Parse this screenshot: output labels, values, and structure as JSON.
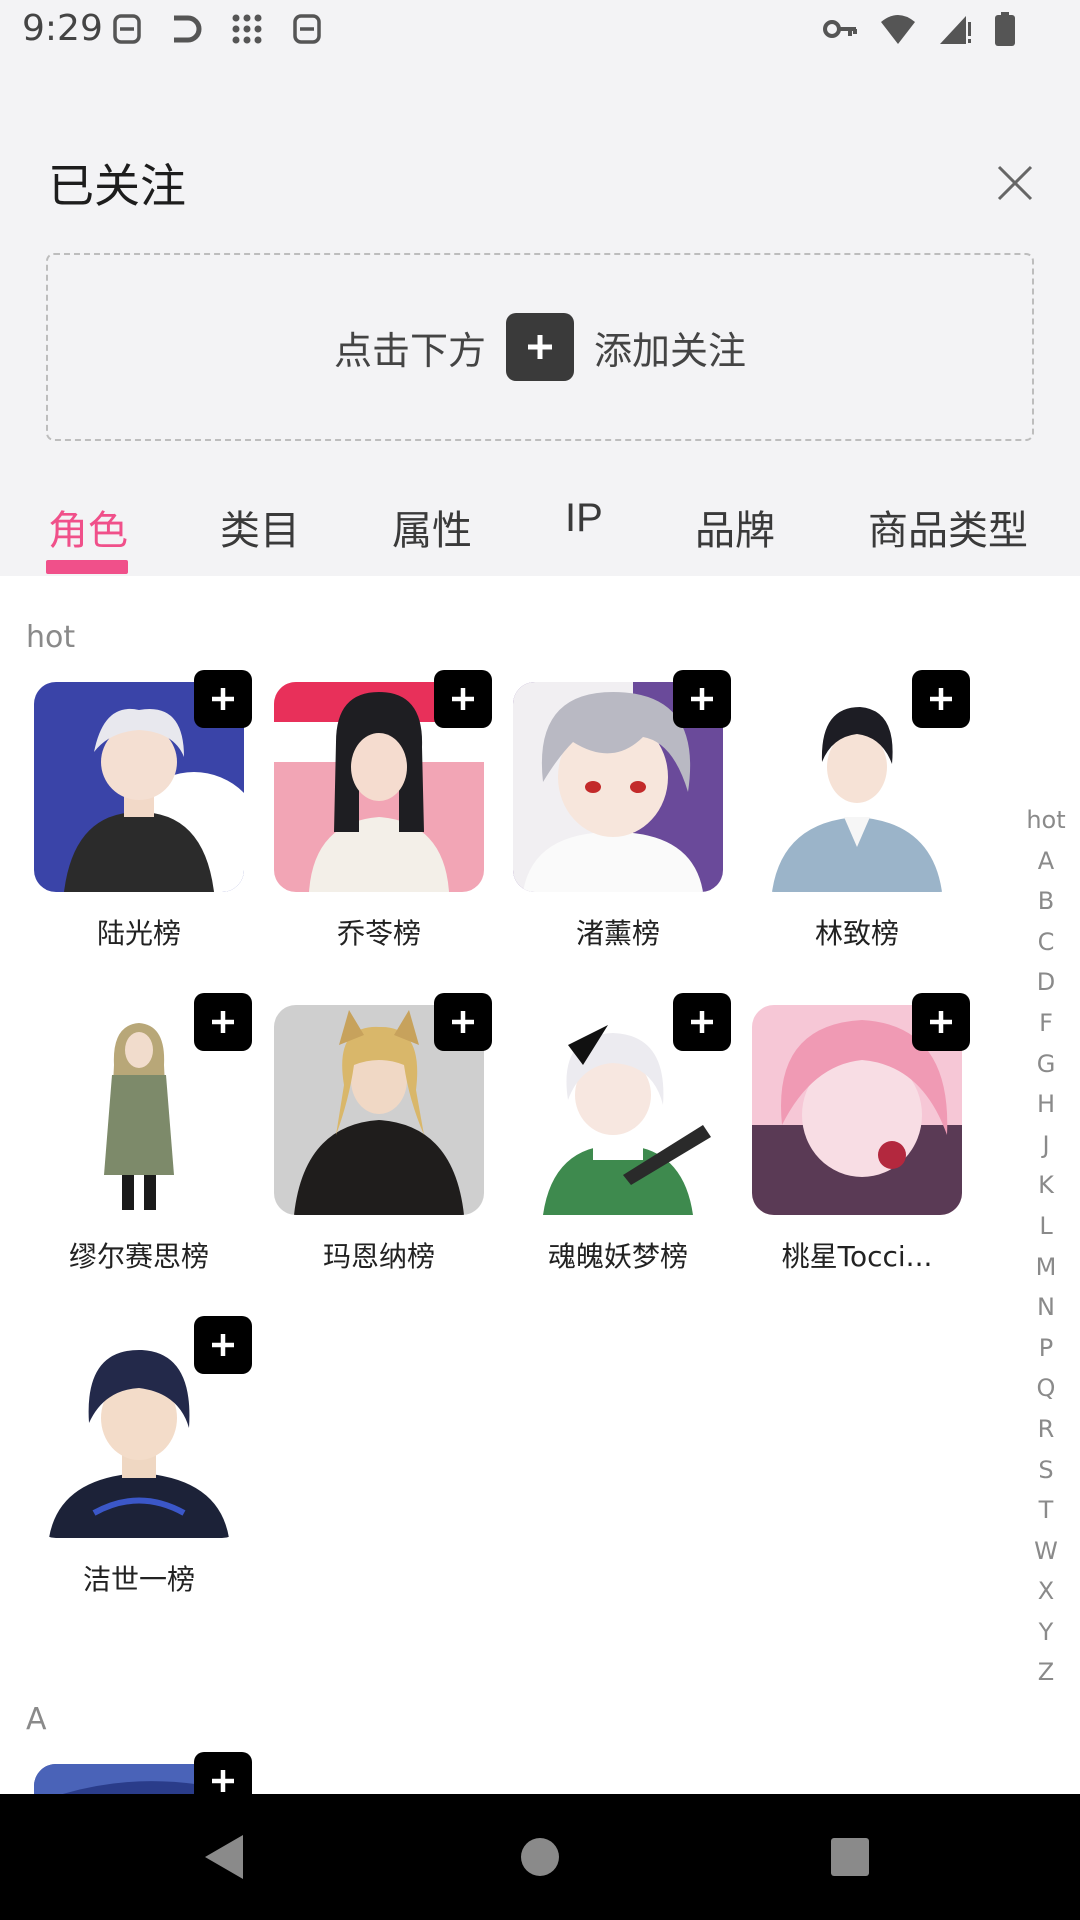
{
  "status_bar": {
    "time": "9:29"
  },
  "header": {
    "title": "已关注"
  },
  "follow_box": {
    "hint_prefix": "点击下方",
    "hint_suffix": "添加关注"
  },
  "tabs": [
    {
      "label": "角色",
      "active": true
    },
    {
      "label": "类目"
    },
    {
      "label": "属性"
    },
    {
      "label": "IP"
    },
    {
      "label": "品牌"
    },
    {
      "label": "商品类型"
    }
  ],
  "sections": {
    "hot": {
      "label": "hot",
      "items": [
        {
          "label": "陆光榜"
        },
        {
          "label": "乔苓榜"
        },
        {
          "label": "渚薰榜"
        },
        {
          "label": "林致榜"
        },
        {
          "label": "缪尔赛思榜"
        },
        {
          "label": "玛恩纳榜"
        },
        {
          "label": "魂魄妖梦榜"
        },
        {
          "label": "桃星Tocci..."
        },
        {
          "label": "洁世一榜"
        }
      ]
    },
    "a": {
      "label": "A"
    }
  },
  "index_bar": [
    "hot",
    "A",
    "B",
    "C",
    "D",
    "F",
    "G",
    "H",
    "J",
    "K",
    "L",
    "M",
    "N",
    "P",
    "Q",
    "R",
    "S",
    "T",
    "W",
    "X",
    "Y",
    "Z"
  ],
  "colors": {
    "accent": "#f0508a",
    "page_bg": "#f3f3f5",
    "badge": "#000000"
  }
}
